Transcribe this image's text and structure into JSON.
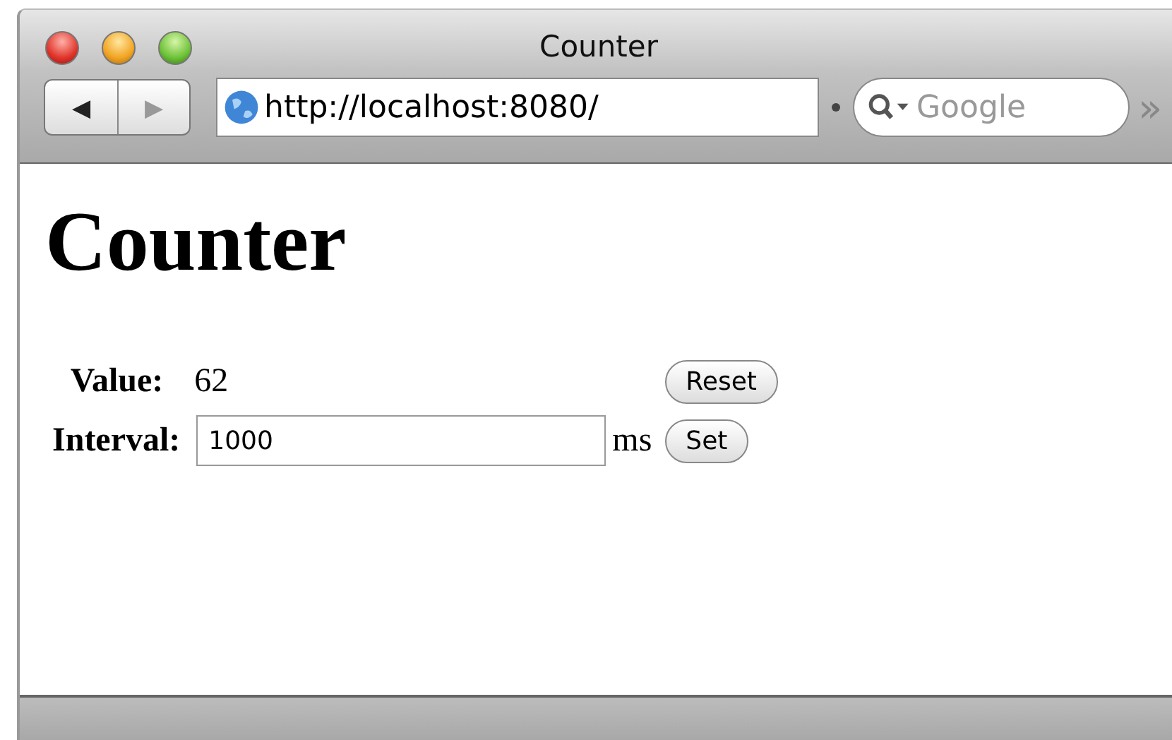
{
  "window": {
    "title": "Counter"
  },
  "toolbar": {
    "back": "◀",
    "forward": "▶",
    "address": "http://localhost:8080/",
    "search": {
      "placeholder": "Google"
    },
    "overflow": "»"
  },
  "page": {
    "heading": "Counter",
    "value": {
      "label": "Value:",
      "text": "62",
      "button": "Reset"
    },
    "interval": {
      "label": "Interval:",
      "value": "1000",
      "unit": "ms",
      "button": "Set"
    }
  }
}
